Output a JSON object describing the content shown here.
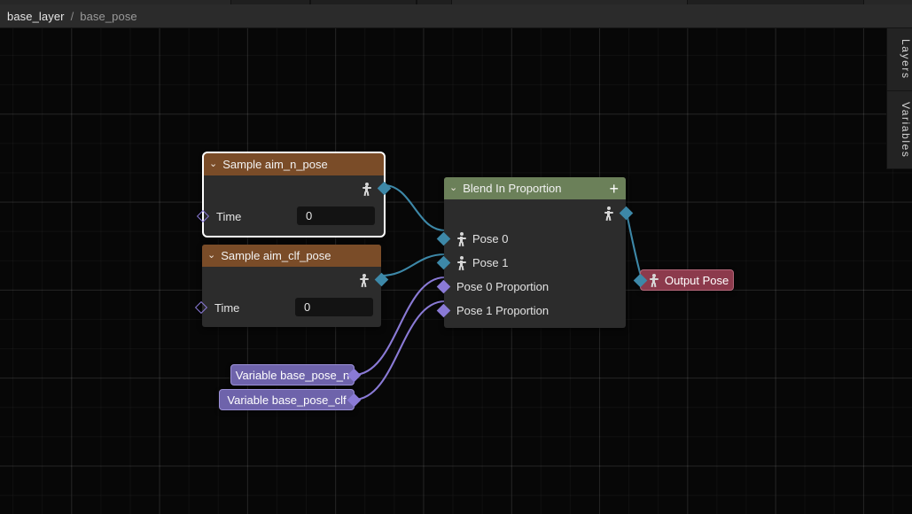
{
  "window": {
    "top_tabs": [
      {
        "name": "tab-slot-1"
      },
      {
        "name": "tab-slot-2"
      },
      {
        "name": "tab-slot-3"
      },
      {
        "name": "tab-slot-4"
      }
    ]
  },
  "breadcrumb": {
    "root": "base_layer",
    "separator": "/",
    "current": "base_pose"
  },
  "side_panel": {
    "tabs": [
      {
        "label": "Layers"
      },
      {
        "label": "Variables"
      }
    ]
  },
  "colors": {
    "node_header_sample": "#7a4c28",
    "node_header_blend": "#6b8059",
    "node_body": "#2c2c2c",
    "pin_pose": "#3d88a8",
    "pin_number": "#8a7ad6",
    "variable_node": "#6e63ab",
    "output_node": "#8c3a4c",
    "wire_pose": "#3d88a8",
    "wire_number": "#8a7ad6",
    "selection": "#ffffff",
    "canvas_bg": "#070707"
  },
  "graph": {
    "nodes": [
      {
        "id": "sample-aim-n-pose",
        "title": "Sample aim_n_pose",
        "caret": "⌄",
        "selected": true,
        "outputs": [
          {
            "label": "",
            "type": "pose",
            "icon": "pose-figure-icon"
          }
        ],
        "inputs": [
          {
            "label": "Time",
            "type": "number",
            "value": "0"
          }
        ]
      },
      {
        "id": "sample-aim-clf-pose",
        "title": "Sample aim_clf_pose",
        "caret": "⌄",
        "selected": false,
        "outputs": [
          {
            "label": "",
            "type": "pose",
            "icon": "pose-figure-icon"
          }
        ],
        "inputs": [
          {
            "label": "Time",
            "type": "number",
            "value": "0"
          }
        ]
      },
      {
        "id": "blend-in-proportion",
        "title": "Blend In Proportion",
        "caret": "⌄",
        "add_label": "+",
        "selected": false,
        "outputs": [
          {
            "label": "",
            "type": "pose",
            "icon": "pose-figure-icon"
          }
        ],
        "inputs": [
          {
            "label": "Pose 0",
            "type": "pose",
            "icon": "pose-figure-icon"
          },
          {
            "label": "Pose 1",
            "type": "pose",
            "icon": "pose-figure-icon"
          },
          {
            "label": "Pose 0 Proportion",
            "type": "number"
          },
          {
            "label": "Pose 1 Proportion",
            "type": "number"
          }
        ]
      },
      {
        "id": "variable-base-pose-n",
        "title": "Variable base_pose_n",
        "kind": "variable"
      },
      {
        "id": "variable-base-pose-clf",
        "title": "Variable base_pose_clf",
        "kind": "variable"
      },
      {
        "id": "output-pose",
        "title": "Output Pose",
        "kind": "output",
        "icon": "pose-figure-icon"
      }
    ]
  }
}
